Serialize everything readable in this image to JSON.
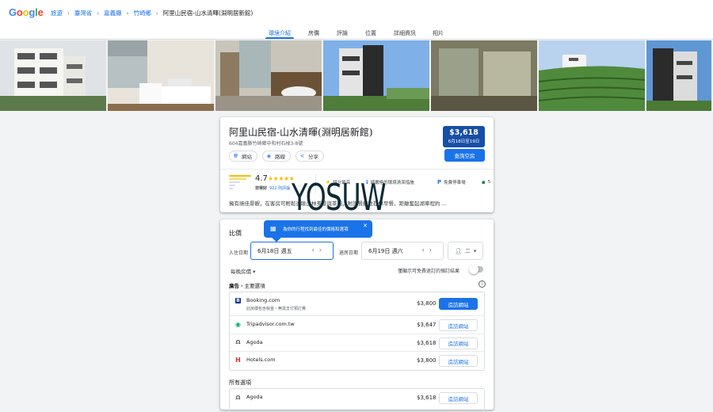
{
  "header": {
    "logo": "Google",
    "breadcrumbs": [
      "旅遊",
      "臺灣省",
      "嘉義縣",
      "竹崎鄉",
      "阿里山民宿-山水清暉(淵明居新館)"
    ]
  },
  "tabs": [
    {
      "label": "環境介紹",
      "active": true
    },
    {
      "label": "房價",
      "active": false
    },
    {
      "label": "評論",
      "active": false
    },
    {
      "label": "位置",
      "active": false
    },
    {
      "label": "詳細資訊",
      "active": false
    },
    {
      "label": "相片",
      "active": false
    }
  ],
  "hotel": {
    "name": "阿里山民宿-山水清暉(淵明居新館)",
    "address": "604嘉義縣竹崎鄉中和村石棹3-8號",
    "chips": [
      {
        "icon": "globe-icon",
        "label": "網站"
      },
      {
        "icon": "directions-icon",
        "label": "路線"
      },
      {
        "icon": "share-icon",
        "label": "分享"
      }
    ],
    "price": "$3,618",
    "price_dates": "6月18日至19日",
    "check_button": "查詢空房",
    "rating": "4.7",
    "stars": "★★★★★",
    "rating_label": "非常好",
    "review_count": "922 則評論",
    "amenities": [
      {
        "icon": "star-icon",
        "label": "評分最高"
      },
      {
        "icon": "info-icon",
        "label": "經嚴格的環境清潔措施"
      },
      {
        "icon": "parking-icon",
        "label": "免費停車場"
      },
      {
        "icon": "more-icon",
        "label": "5"
      }
    ],
    "description": "擁有絕佳景觀，在客房可輕鬆遠眺山林美景與茶園，附設餐廳並提供早餐，距離奮起湖車程約 ..."
  },
  "watermark": "YOSUW",
  "pricing": {
    "title": "比價",
    "tooltip": "為你的行程找到最佳的價格和選項",
    "checkin_label": "入住日期",
    "checkin_value": "6月18日 週五",
    "checkout_label": "退房日期",
    "checkout_value": "6月19日 週六",
    "guests": "二",
    "nightly": "每晚房價",
    "free_cancel": "僅顯示可免費退訂的預訂結果",
    "ads_prefix": "廣告",
    "ads_label": "・主要選項",
    "offers": [
      {
        "name": "Booking.com",
        "sub": "此房價包含稅金・無需支付預訂費",
        "price": "$3,800",
        "button": "造訪網站",
        "primary": true,
        "icon": "booking-icon",
        "color": "#003580"
      },
      {
        "name": "Tripadvisor.com.tw",
        "sub": "",
        "price": "$3,647",
        "button": "造訪網站",
        "primary": false,
        "icon": "tripadvisor-icon",
        "color": "#00aa6c"
      },
      {
        "name": "Agoda",
        "sub": "",
        "price": "$3,618",
        "button": "造訪網站",
        "primary": false,
        "icon": "agoda-icon",
        "color": "#5f6368"
      },
      {
        "name": "Hotels.com",
        "sub": "",
        "price": "$3,800",
        "button": "造訪網站",
        "primary": false,
        "icon": "hotels-icon",
        "color": "#d32f2f"
      }
    ],
    "all_options": "所有選項",
    "all_offers": [
      {
        "name": "Agoda",
        "price": "$3,618",
        "button": "造訪網站"
      }
    ]
  }
}
